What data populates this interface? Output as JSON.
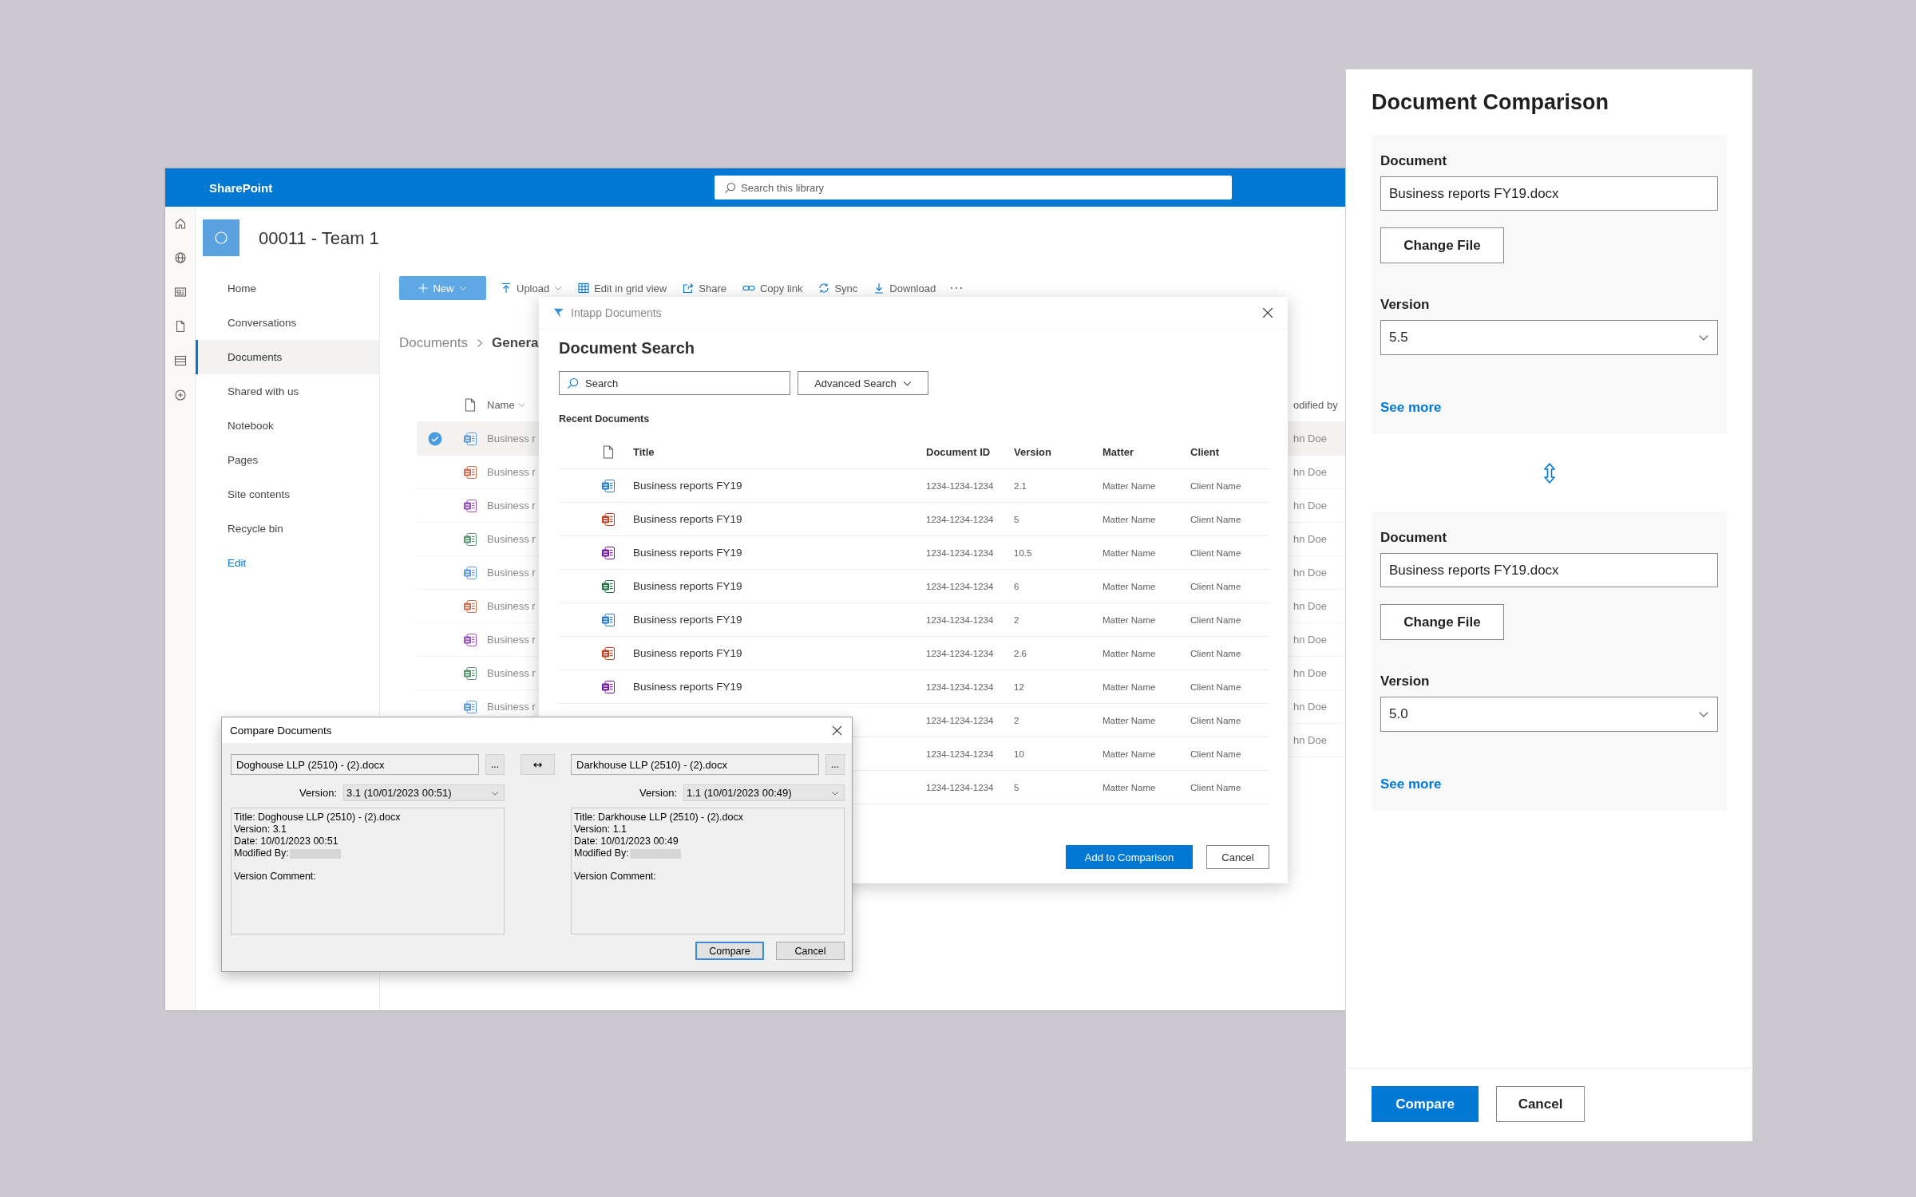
{
  "sharepoint": {
    "app_name": "SharePoint",
    "search": {
      "placeholder": "Search this library"
    },
    "site_title": "00011 - Team 1",
    "nav": [
      {
        "label": "Home",
        "kind": "item",
        "selected": false
      },
      {
        "label": "Conversations",
        "kind": "item",
        "selected": false
      },
      {
        "label": "Documents",
        "kind": "item",
        "selected": true
      },
      {
        "label": "Shared with us",
        "kind": "item",
        "selected": false
      },
      {
        "label": "Notebook",
        "kind": "item",
        "selected": false
      },
      {
        "label": "Pages",
        "kind": "item",
        "selected": false
      },
      {
        "label": "Site contents",
        "kind": "item",
        "selected": false
      },
      {
        "label": "Recycle bin",
        "kind": "item",
        "selected": false
      },
      {
        "label": "Edit",
        "kind": "link",
        "selected": false
      }
    ],
    "toolbar": [
      {
        "label": "New",
        "kind": "primary"
      },
      {
        "label": "Upload",
        "kind": "menu"
      },
      {
        "label": "Edit in grid view",
        "kind": "plain"
      },
      {
        "label": "Share",
        "kind": "plain"
      },
      {
        "label": "Copy link",
        "kind": "plain"
      },
      {
        "label": "Sync",
        "kind": "plain"
      },
      {
        "label": "Download",
        "kind": "plain"
      }
    ],
    "breadcrumb": [
      "Documents",
      "Genera"
    ],
    "list": {
      "columns": [
        "Name",
        "odified by"
      ],
      "rows": [
        {
          "kind": "word",
          "name": "Business r",
          "modified_by": "hn Doe",
          "selected": true
        },
        {
          "kind": "powerpoint",
          "name": "Business r",
          "modified_by": "hn Doe",
          "selected": false
        },
        {
          "kind": "onenote",
          "name": "Business r",
          "modified_by": "hn Doe",
          "selected": false
        },
        {
          "kind": "excel",
          "name": "Business r",
          "modified_by": "hn Doe",
          "selected": false
        },
        {
          "kind": "word",
          "name": "Business r",
          "modified_by": "hn Doe",
          "selected": false
        },
        {
          "kind": "powerpoint",
          "name": "Business r",
          "modified_by": "hn Doe",
          "selected": false
        },
        {
          "kind": "onenote",
          "name": "Business r",
          "modified_by": "hn Doe",
          "selected": false
        },
        {
          "kind": "excel",
          "name": "Business r",
          "modified_by": "hn Doe",
          "selected": false
        },
        {
          "kind": "word",
          "name": "Business r",
          "modified_by": "hn Doe",
          "selected": false
        },
        {
          "modified_by": "hn Doe",
          "selected": false
        }
      ]
    }
  },
  "intapp": {
    "title": "Intapp Documents",
    "heading": "Document Search",
    "search": {
      "placeholder": "Search"
    },
    "advanced_search": "Advanced Search",
    "section_title": "Recent Documents",
    "columns": [
      "Title",
      "Document ID",
      "Version",
      "Matter",
      "Client"
    ],
    "rows": [
      {
        "kind": "word",
        "title": "Business reports FY19",
        "document_id": "1234-1234-1234",
        "version": "2.1",
        "matter": "Matter Name",
        "client": "Client Name"
      },
      {
        "kind": "powerpoint",
        "title": "Business reports FY19",
        "document_id": "1234-1234-1234",
        "version": "5",
        "matter": "Matter Name",
        "client": "Client Name"
      },
      {
        "kind": "onenote",
        "title": "Business reports FY19",
        "document_id": "1234-1234-1234",
        "version": "10.5",
        "matter": "Matter Name",
        "client": "Client Name"
      },
      {
        "kind": "excel",
        "title": "Business reports FY19",
        "document_id": "1234-1234-1234",
        "version": "6",
        "matter": "Matter Name",
        "client": "Client Name"
      },
      {
        "kind": "word",
        "title": "Business reports FY19",
        "document_id": "1234-1234-1234",
        "version": "2",
        "matter": "Matter Name",
        "client": "Client Name"
      },
      {
        "kind": "powerpoint",
        "title": "Business reports FY19",
        "document_id": "1234-1234-1234",
        "version": "2.6",
        "matter": "Matter Name",
        "client": "Client Name"
      },
      {
        "kind": "onenote",
        "title": "Business reports FY19",
        "document_id": "1234-1234-1234",
        "version": "12",
        "matter": "Matter Name",
        "client": "Client Name"
      },
      {
        "document_id": "1234-1234-1234",
        "version": "2",
        "matter": "Matter Name",
        "client": "Client Name"
      },
      {
        "document_id": "1234-1234-1234",
        "version": "10",
        "matter": "Matter Name",
        "client": "Client Name"
      },
      {
        "document_id": "1234-1234-1234",
        "version": "5",
        "matter": "Matter Name",
        "client": "Client Name"
      }
    ],
    "buttons": [
      {
        "label": "Add to Comparison",
        "kind": "primary"
      },
      {
        "label": "Cancel",
        "kind": "secondary"
      }
    ]
  },
  "compare": {
    "title": "Compare Documents",
    "swap": "↔",
    "panes": [
      {
        "file": "Doghouse LLP (2510) - (2).docx",
        "browse": "...",
        "version_label": "Version:",
        "version": "3.1 (10/01/2023 00:51)",
        "details": [
          {
            "kind": "line",
            "text": "Title: Doghouse LLP (2510) - (2).docx"
          },
          {
            "kind": "line",
            "text": "Version: 3.1"
          },
          {
            "kind": "line",
            "text": "Date: 10/01/2023 00:51"
          },
          {
            "kind": "redacted",
            "text": "Modified By:"
          },
          {
            "kind": "spaced",
            "text": "Version Comment:"
          }
        ]
      },
      {
        "file": "Darkhouse LLP (2510) - (2).docx",
        "browse": "...",
        "version_label": "Version:",
        "version": "1.1 (10/01/2023 00:49)",
        "details": [
          {
            "kind": "line",
            "text": "Title: Darkhouse LLP (2510) - (2).docx"
          },
          {
            "kind": "line",
            "text": "Version: 1.1"
          },
          {
            "kind": "line",
            "text": "Date: 10/01/2023 00:49"
          },
          {
            "kind": "redacted",
            "text": "Modified By:"
          },
          {
            "kind": "spaced",
            "text": "Version Comment:"
          }
        ]
      }
    ],
    "buttons": [
      {
        "label": "Compare",
        "default": true
      },
      {
        "label": "Cancel",
        "default": false
      }
    ]
  },
  "comparison": {
    "title": "Document Comparison",
    "documents": [
      {
        "label": "Document",
        "file": "Business reports FY19.docx",
        "change_button": "Change File",
        "version_label": "Version",
        "version": "5.5",
        "see_more": "See more"
      },
      {
        "label": "Document",
        "file": "Business reports FY19.docx",
        "change_button": "Change File",
        "version_label": "Version",
        "version": "5.0",
        "see_more": "See more"
      }
    ],
    "buttons": [
      {
        "label": "Compare",
        "kind": "primary"
      },
      {
        "label": "Cancel",
        "kind": "secondary"
      }
    ]
  }
}
